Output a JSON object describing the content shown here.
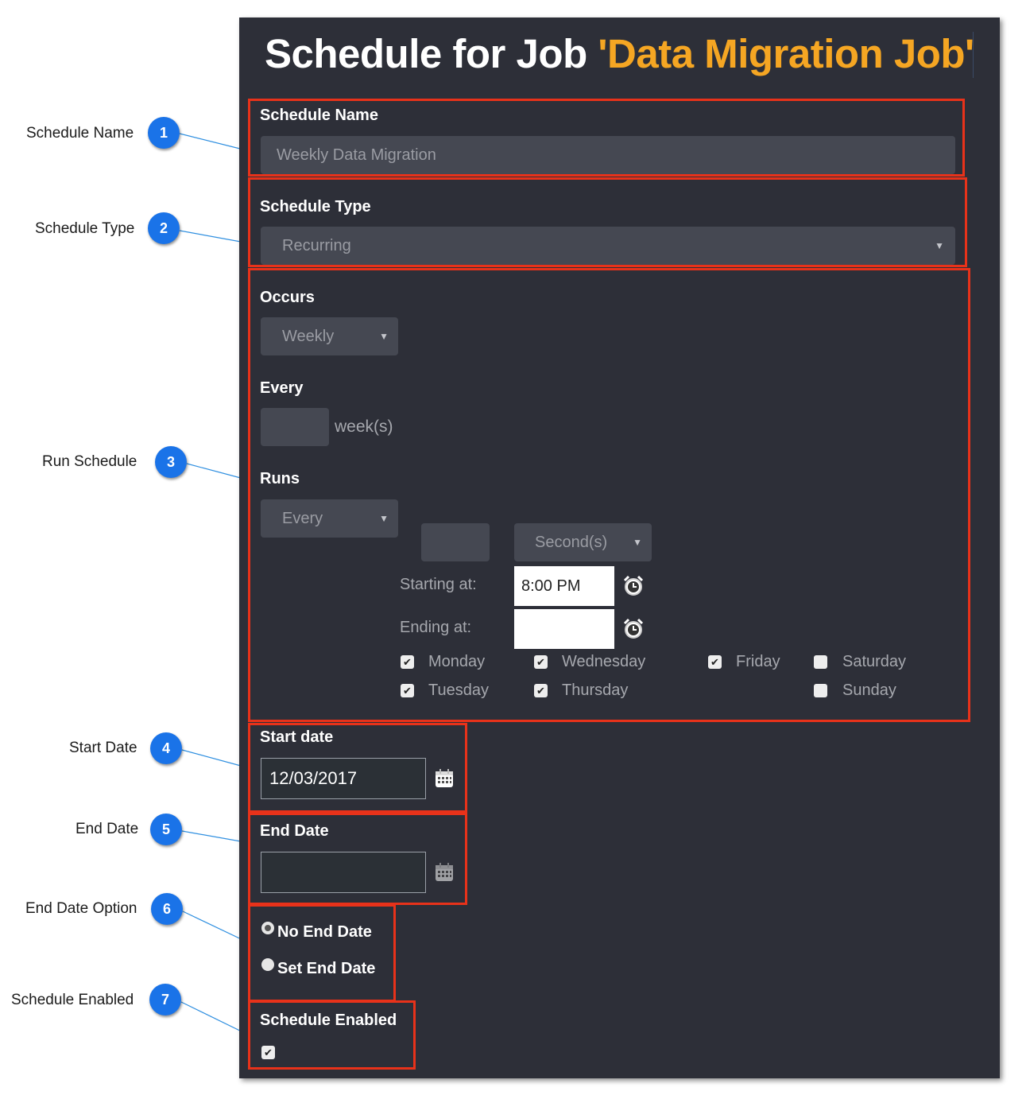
{
  "title": {
    "prefix": "Schedule for Job ",
    "job_name": "'Data Migration Job'"
  },
  "schedule_name": {
    "label": "Schedule Name",
    "value": "Weekly Data Migration"
  },
  "schedule_type": {
    "label": "Schedule Type",
    "value": "Recurring"
  },
  "occurs": {
    "label": "Occurs",
    "value": "Weekly"
  },
  "every": {
    "label": "Every",
    "value": "",
    "unit": "week(s)"
  },
  "runs": {
    "label": "Runs",
    "mode": "Every",
    "interval_value": "",
    "interval_unit": "Second(s)",
    "starting_label": "Starting at:",
    "starting_value": "8:00 PM",
    "ending_label": "Ending at:",
    "ending_value": ""
  },
  "days": [
    {
      "label": "Monday",
      "checked": true
    },
    {
      "label": "Wednesday",
      "checked": true
    },
    {
      "label": "Friday",
      "checked": true
    },
    {
      "label": "Saturday",
      "checked": false
    },
    {
      "label": "Tuesday",
      "checked": true
    },
    {
      "label": "Thursday",
      "checked": true
    },
    {
      "label": "Sunday",
      "checked": false
    }
  ],
  "start_date": {
    "label": "Start date",
    "value": "12/03/2017"
  },
  "end_date": {
    "label": "End Date",
    "value": ""
  },
  "end_date_option": {
    "options": [
      "No End Date",
      "Set End Date"
    ],
    "selected": "No End Date"
  },
  "schedule_enabled": {
    "label": "Schedule Enabled",
    "checked": true
  },
  "annotations": [
    {
      "number": "1",
      "label": "Schedule Name"
    },
    {
      "number": "2",
      "label": "Schedule Type"
    },
    {
      "number": "3",
      "label": "Run Schedule"
    },
    {
      "number": "4",
      "label": "Start Date"
    },
    {
      "number": "5",
      "label": "End Date"
    },
    {
      "number": "6",
      "label": "End Date Option"
    },
    {
      "number": "7",
      "label": "Schedule Enabled"
    }
  ],
  "colors": {
    "panel": "#2d2f38",
    "accent": "#f5a623",
    "highlight_box": "#e8321a",
    "badge": "#1a73e8"
  },
  "icons": {
    "time": "alarm-clock-icon",
    "date": "calendar-icon",
    "check": "checkmark-icon"
  }
}
